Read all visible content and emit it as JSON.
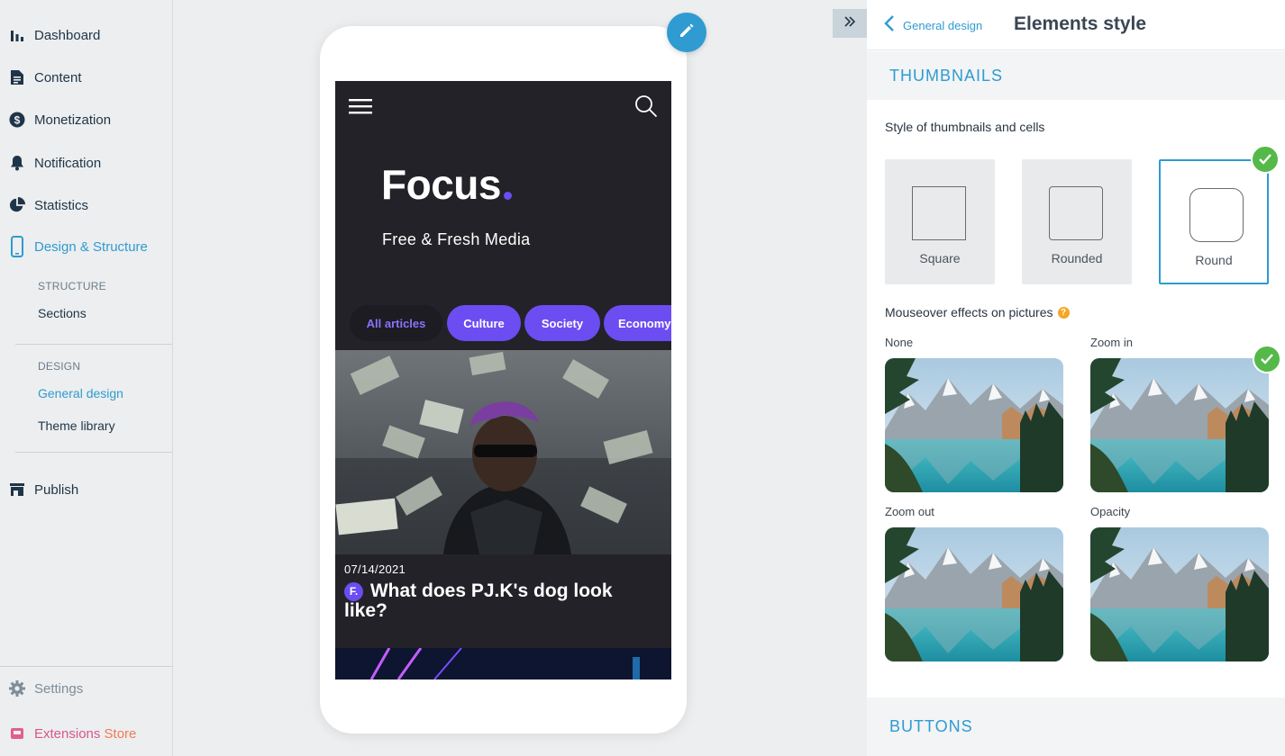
{
  "sidebar": {
    "items": [
      {
        "label": "Dashboard",
        "icon": "bar-chart-icon"
      },
      {
        "label": "Content",
        "icon": "document-icon"
      },
      {
        "label": "Monetization",
        "icon": "dollar-icon"
      },
      {
        "label": "Notification",
        "icon": "bell-icon"
      },
      {
        "label": "Statistics",
        "icon": "pie-chart-icon"
      },
      {
        "label": "Design & Structure",
        "icon": "mobile-icon"
      }
    ],
    "structure_heading": "STRUCTURE",
    "structure_items": [
      "Sections"
    ],
    "design_heading": "DESIGN",
    "design_items": [
      "General design",
      "Theme library"
    ],
    "publish": "Publish",
    "settings": "Settings",
    "extensions_word1": "Extensions",
    "extensions_word2": "Store"
  },
  "preview": {
    "logo": "Focus",
    "tagline": "Free & Fresh Media",
    "categories": [
      "All articles",
      "Culture",
      "Society",
      "Economy"
    ],
    "article": {
      "date": "07/14/2021",
      "badge": "F.",
      "title": "What does PJ.K's dog look like?"
    }
  },
  "panel": {
    "back_label": "General design",
    "title": "Elements style",
    "thumbnails_heading": "THUMBNAILS",
    "thumb_style_label": "Style of thumbnails and cells",
    "thumb_options": [
      "Square",
      "Rounded",
      "Round"
    ],
    "thumb_selected": "Round",
    "mouseover_label": "Mouseover effects on pictures",
    "effects": [
      "None",
      "Zoom in",
      "Zoom out",
      "Opacity"
    ],
    "effect_selected": "Zoom in",
    "buttons_heading": "BUTTONS"
  },
  "colors": {
    "accent": "#2f9bd1",
    "brand_purple": "#6b4df2",
    "check_green": "#54b948"
  }
}
